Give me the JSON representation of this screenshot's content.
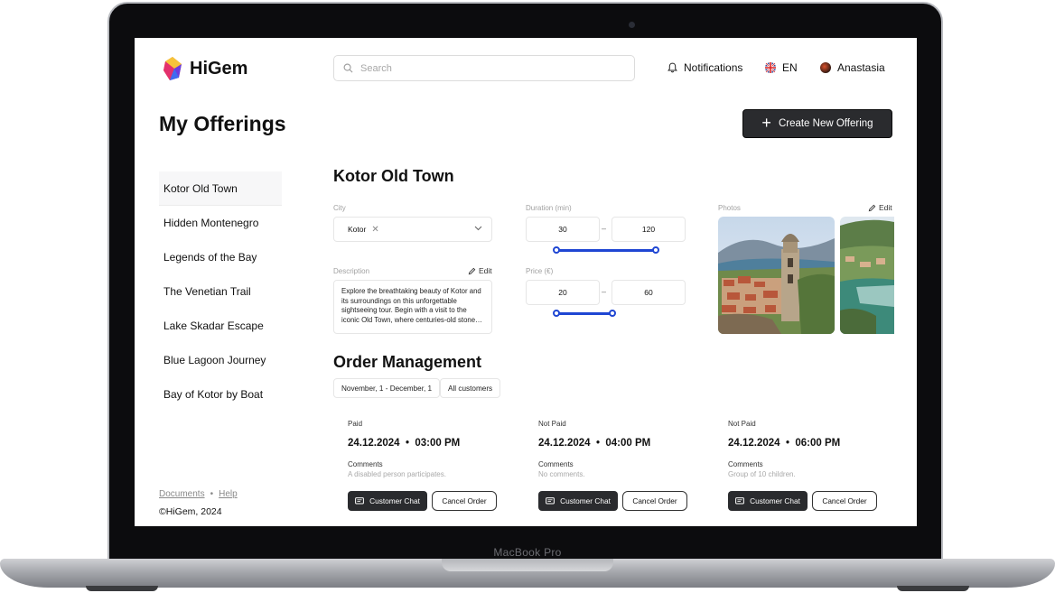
{
  "device": {
    "label": "MacBook Pro"
  },
  "header": {
    "logo_text": "HiGem",
    "search_placeholder": "Search",
    "notifications_label": "Notifications",
    "language": "EN",
    "user_name": "Anastasia"
  },
  "page": {
    "title": "My Offerings",
    "create_button": "Create New Offering"
  },
  "sidebar": {
    "items": [
      {
        "label": "Kotor Old Town"
      },
      {
        "label": "Hidden Montenegro"
      },
      {
        "label": "Legends of the Bay"
      },
      {
        "label": "The Venetian Trail"
      },
      {
        "label": "Lake Skadar Escape"
      },
      {
        "label": "Blue Lagoon Journey"
      },
      {
        "label": "Bay of Kotor by Boat"
      }
    ],
    "footer": {
      "documents": "Documents",
      "separator": "•",
      "help": "Help",
      "copyright": "©HiGem, 2024"
    }
  },
  "offering": {
    "title": "Kotor Old Town",
    "city": {
      "label": "City",
      "value": "Kotor"
    },
    "duration": {
      "label": "Duration (min)",
      "min": "30",
      "max": "120"
    },
    "price": {
      "label": "Price (€)",
      "min": "20",
      "max": "60"
    },
    "description": {
      "label": "Description",
      "edit": "Edit",
      "text": "Explore the breathtaking beauty of Kotor and its surroundings on this unforgettable sightseeing tour. Begin with a visit to the iconic Old Town, where centuries-old stone…"
    },
    "photos": {
      "label": "Photos",
      "edit": "Edit"
    }
  },
  "orders": {
    "title": "Order Management",
    "filters": {
      "date_range": "November, 1 - December, 1",
      "customers": "All customers"
    },
    "items": [
      {
        "status": "Paid",
        "date": "24.12.2024",
        "time": "03:00 PM",
        "comments_label": "Comments",
        "comment": "A disabled person participates.",
        "chat_button": "Customer Chat",
        "cancel_button": "Cancel Order"
      },
      {
        "status": "Not Paid",
        "date": "24.12.2024",
        "time": "04:00 PM",
        "comments_label": "Comments",
        "comment": "No comments.",
        "chat_button": "Customer Chat",
        "cancel_button": "Cancel Order"
      },
      {
        "status": "Not Paid",
        "date": "24.12.2024",
        "time": "06:00 PM",
        "comments_label": "Comments",
        "comment": "Group of 10 children.",
        "chat_button": "Customer Chat",
        "cancel_button": "Cancel Order"
      }
    ]
  },
  "colors": {
    "accent": "#1f46d3",
    "dark_button": "#2a2b2e"
  }
}
